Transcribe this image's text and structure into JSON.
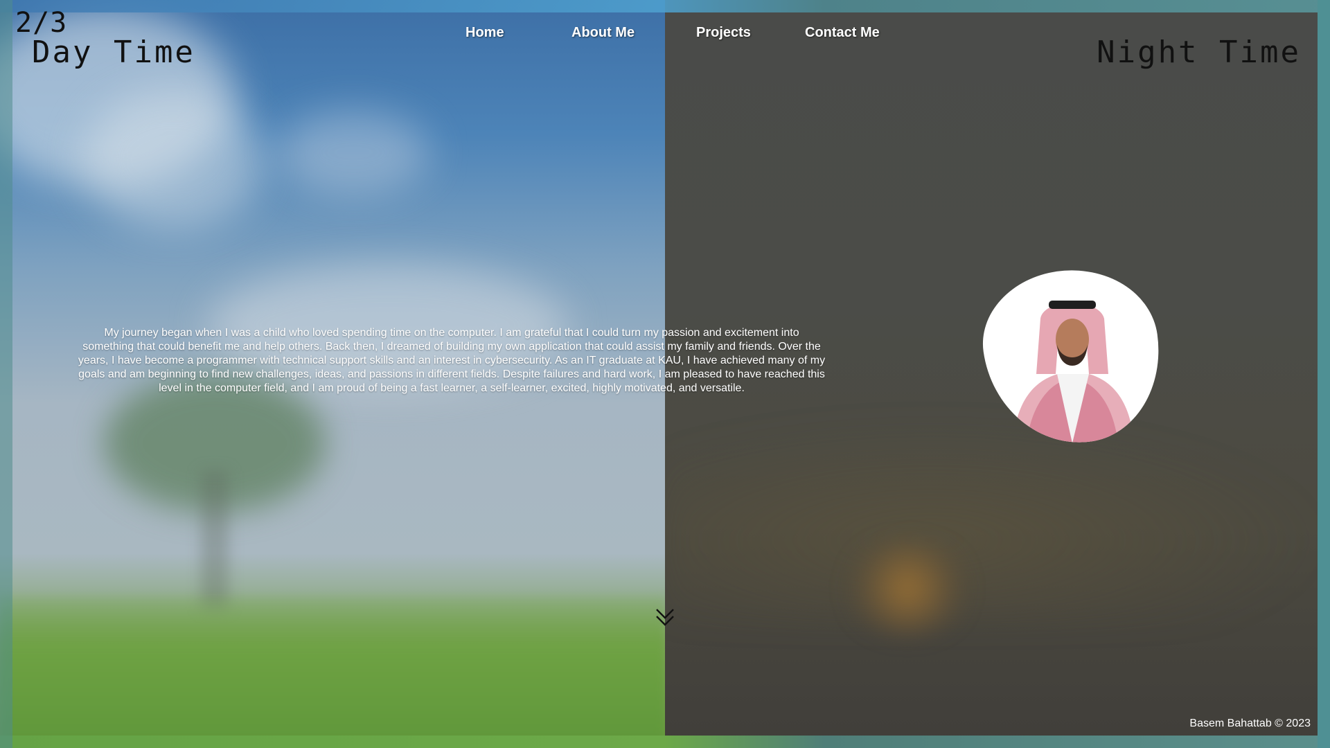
{
  "page": {
    "counter": "2/3",
    "day_title": "Day Time",
    "night_title": "Night Time"
  },
  "nav": {
    "items": [
      "Home",
      "About Me",
      "Projects",
      "Contact Me"
    ]
  },
  "about": {
    "bio": "My journey began when I was a child who loved spending time on the computer. I am grateful that I could turn my passion and excitement into something that could benefit me and help others. Back then, I dreamed of building my own application that could assist my family and friends. Over the years, I have become a programmer with technical support skills and an interest in cybersecurity. As an IT graduate at KAU, I have achieved many of my goals and am beginning to find new challenges, ideas, and passions in different fields. Despite failures and hard work, I am pleased to have reached this level in the computer field, and I am proud of being a fast learner, a self-learner, excited, highly motivated, and versatile."
  },
  "footer": {
    "text": "Basem Bahattab © 2023"
  },
  "icons": {
    "scroll": "double-chevron-down-icon"
  }
}
